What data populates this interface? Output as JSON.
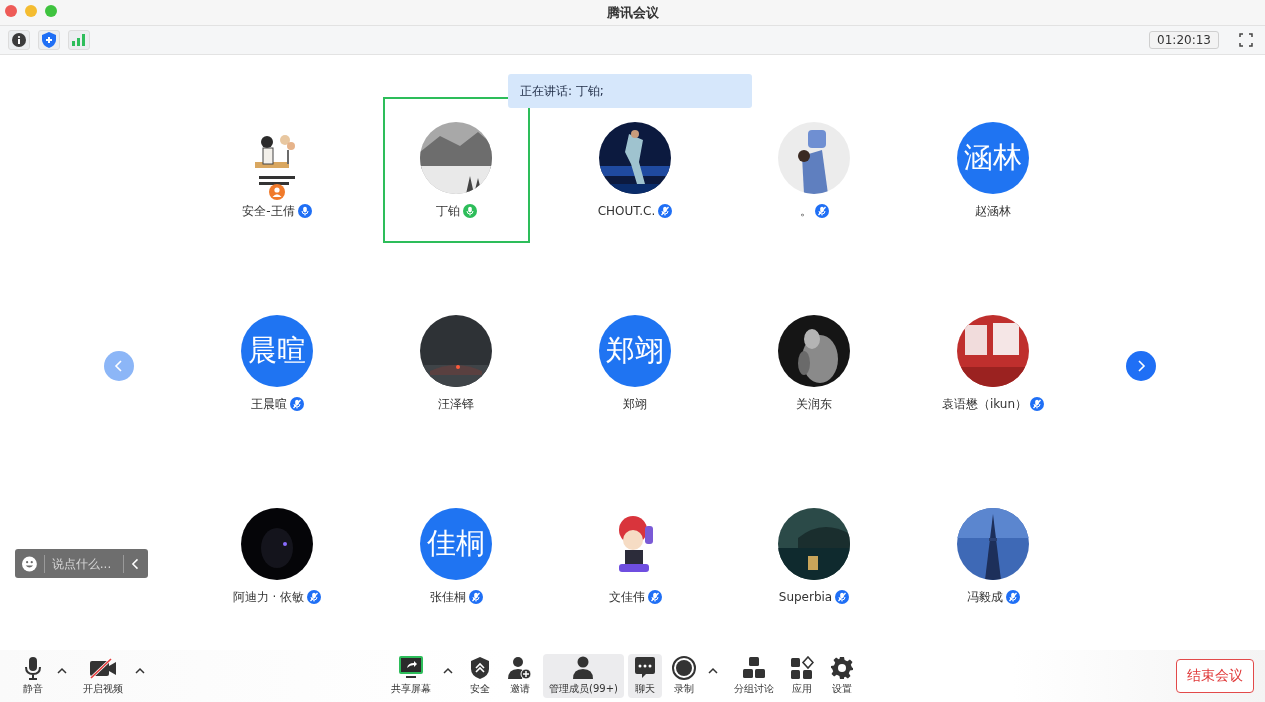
{
  "window": {
    "title": "腾讯会议"
  },
  "top_bar": {
    "timer": "01:20:13"
  },
  "speaking_banner": {
    "label": "正在讲话: 丁铂;"
  },
  "pager": {
    "prev_enabled": false,
    "next_enabled": true
  },
  "participants": [
    {
      "name": "安全-王倩",
      "kind": "picture",
      "host": true,
      "mic": {
        "kind": "on"
      },
      "selected": false
    },
    {
      "name": "丁铂",
      "kind": "picture",
      "host": false,
      "mic": {
        "kind": "speaking"
      },
      "selected": true
    },
    {
      "name": "CHOUT.C.",
      "kind": "picture",
      "host": false,
      "mic": {
        "kind": "muted"
      },
      "selected": false
    },
    {
      "name": "。",
      "kind": "picture",
      "host": false,
      "mic": {
        "kind": "muted"
      },
      "selected": false
    },
    {
      "name": "赵涵林",
      "kind": "text",
      "avatar_text": "涵林",
      "host": false,
      "selected": false
    },
    {
      "name": "王晨暄",
      "kind": "text",
      "avatar_text": "晨暄",
      "host": false,
      "mic": {
        "kind": "muted"
      },
      "selected": false
    },
    {
      "name": "汪泽铎",
      "kind": "picture",
      "host": false,
      "selected": false
    },
    {
      "name": "郑翊",
      "kind": "text",
      "avatar_text": "郑翊",
      "host": false,
      "selected": false
    },
    {
      "name": "关润东",
      "kind": "picture",
      "host": false,
      "selected": false
    },
    {
      "name": "袁语懋（ikun）",
      "kind": "picture",
      "host": false,
      "mic": {
        "kind": "muted"
      },
      "selected": false
    },
    {
      "name": "阿迪力 · 依敏",
      "kind": "picture",
      "host": false,
      "mic": {
        "kind": "muted"
      },
      "selected": false
    },
    {
      "name": "张佳桐",
      "kind": "text",
      "avatar_text": "佳桐",
      "host": false,
      "mic": {
        "kind": "muted"
      },
      "selected": false
    },
    {
      "name": "文佳伟",
      "kind": "picture",
      "host": false,
      "mic": {
        "kind": "muted"
      },
      "selected": false
    },
    {
      "name": "Superbia",
      "kind": "picture",
      "host": false,
      "mic": {
        "kind": "muted"
      },
      "selected": false
    },
    {
      "name": "冯毅成",
      "kind": "picture",
      "host": false,
      "mic": {
        "kind": "muted"
      },
      "selected": false
    }
  ],
  "chat_input": {
    "placeholder": "说点什么..."
  },
  "toolbar_left": [
    {
      "kind": "mic",
      "label": "静音",
      "caret": true,
      "selected": false
    },
    {
      "kind": "video",
      "label": "开启视频",
      "caret": true,
      "selected": false
    }
  ],
  "toolbar_center": [
    {
      "kind": "share",
      "label": "共享屏幕",
      "caret": true,
      "selected": false
    },
    {
      "kind": "security",
      "label": "安全",
      "caret": false,
      "selected": false
    },
    {
      "kind": "invite",
      "label": "邀请",
      "caret": false,
      "selected": false
    },
    {
      "kind": "members",
      "label": "管理成员(99+)",
      "caret": false,
      "selected": true
    },
    {
      "kind": "chat",
      "label": "聊天",
      "caret": false,
      "selected": true
    },
    {
      "kind": "record",
      "label": "录制",
      "caret": true,
      "selected": false
    },
    {
      "kind": "breakout",
      "label": "分组讨论",
      "caret": false,
      "selected": false
    },
    {
      "kind": "apps",
      "label": "应用",
      "caret": false,
      "selected": false
    },
    {
      "kind": "settings",
      "label": "设置",
      "caret": false,
      "selected": false
    }
  ],
  "end_button": {
    "label": "结束会议"
  }
}
